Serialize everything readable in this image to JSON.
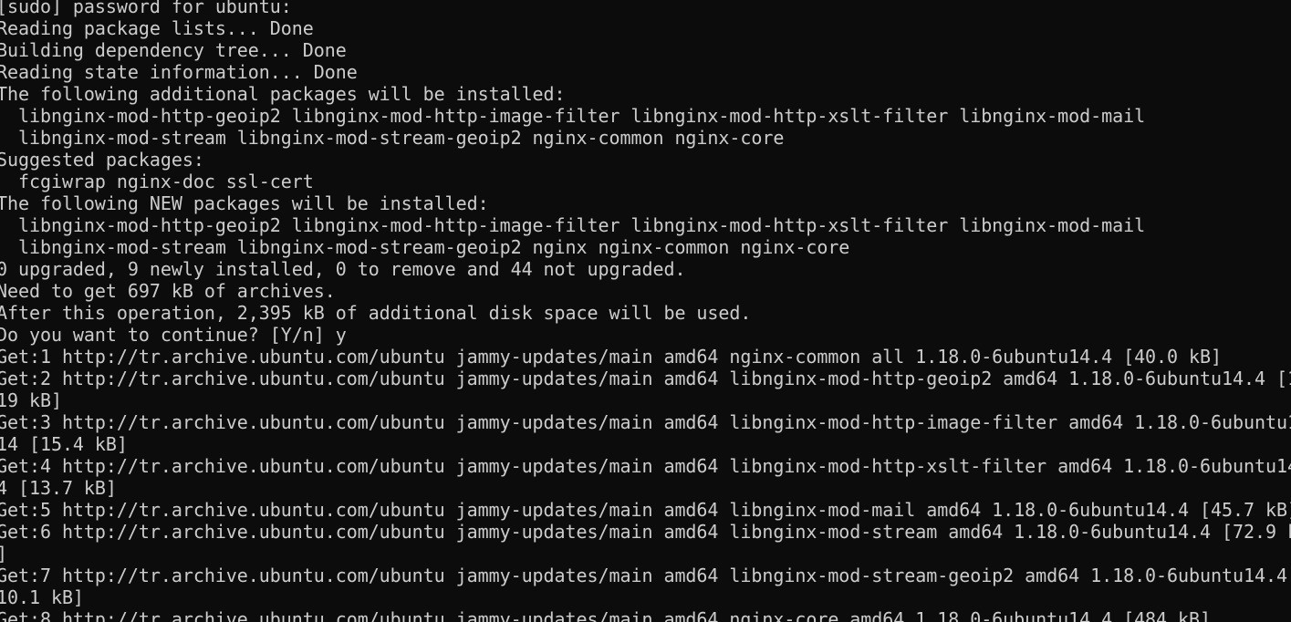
{
  "terminal": {
    "lines": [
      "[sudo] password for ubuntu:",
      "Reading package lists... Done",
      "Building dependency tree... Done",
      "Reading state information... Done",
      "The following additional packages will be installed:",
      "  libnginx-mod-http-geoip2 libnginx-mod-http-image-filter libnginx-mod-http-xslt-filter libnginx-mod-mail",
      "  libnginx-mod-stream libnginx-mod-stream-geoip2 nginx-common nginx-core",
      "Suggested packages:",
      "  fcgiwrap nginx-doc ssl-cert",
      "The following NEW packages will be installed:",
      "  libnginx-mod-http-geoip2 libnginx-mod-http-image-filter libnginx-mod-http-xslt-filter libnginx-mod-mail",
      "  libnginx-mod-stream libnginx-mod-stream-geoip2 nginx nginx-common nginx-core",
      "0 upgraded, 9 newly installed, 0 to remove and 44 not upgraded.",
      "Need to get 697 kB of archives.",
      "After this operation, 2,395 kB of additional disk space will be used.",
      "Do you want to continue? [Y/n] y",
      "Get:1 http://tr.archive.ubuntu.com/ubuntu jammy-updates/main amd64 nginx-common all 1.18.0-6ubuntu14.4 [40.0 kB]",
      "Get:2 http://tr.archive.ubuntu.com/ubuntu jammy-updates/main amd64 libnginx-mod-http-geoip2 amd64 1.18.0-6ubuntu14.4 [1",
      "19 kB]",
      "Get:3 http://tr.archive.ubuntu.com/ubuntu jammy-updates/main amd64 libnginx-mod-http-image-filter amd64 1.18.0-6ubuntu1",
      "14 [15.4 kB]",
      "Get:4 http://tr.archive.ubuntu.com/ubuntu jammy-updates/main amd64 libnginx-mod-http-xslt-filter amd64 1.18.0-6ubuntu14",
      "4 [13.7 kB]",
      "Get:5 http://tr.archive.ubuntu.com/ubuntu jammy-updates/main amd64 libnginx-mod-mail amd64 1.18.0-6ubuntu14.4 [45.7 kB]",
      "Get:6 http://tr.archive.ubuntu.com/ubuntu jammy-updates/main amd64 libnginx-mod-stream amd64 1.18.0-6ubuntu14.4 [72.9 k",
      "]",
      "Get:7 http://tr.archive.ubuntu.com/ubuntu jammy-updates/main amd64 libnginx-mod-stream-geoip2 amd64 1.18.0-6ubuntu14.4",
      "10.1 kB]",
      "Get:8 http://tr.archive.ubuntu.com/ubuntu jammy-updates/main amd64 nginx-core amd64 1.18.0-6ubuntu14.4 [484 kB]"
    ],
    "colors": {
      "background": "#0c0c0c",
      "foreground": "#cccccc"
    }
  }
}
